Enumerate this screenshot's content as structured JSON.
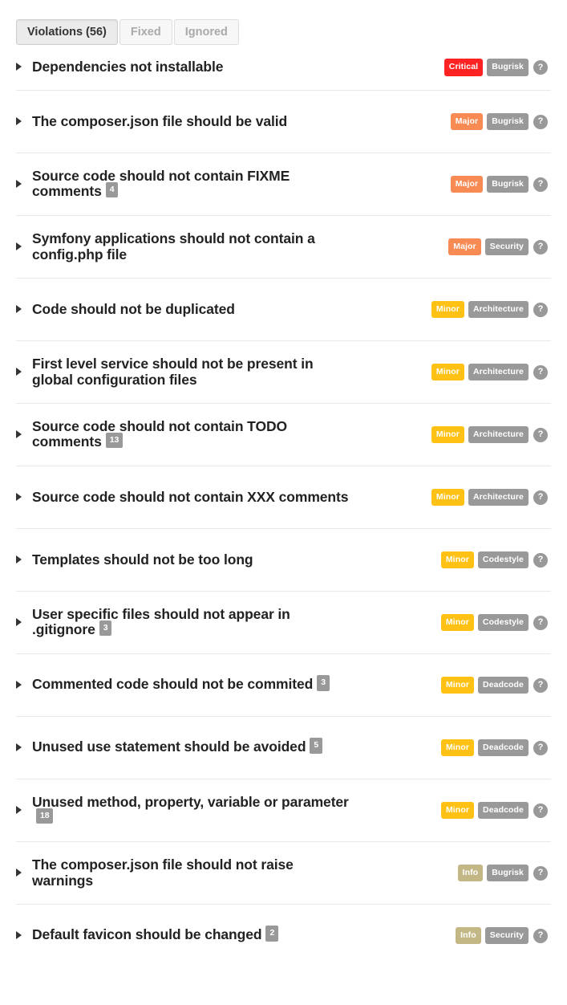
{
  "tabs": [
    {
      "label": "Violations (56)",
      "active": true
    },
    {
      "label": "Fixed",
      "active": false
    },
    {
      "label": "Ignored",
      "active": false
    }
  ],
  "help_icon_label": "?",
  "violations": [
    {
      "title": "Dependencies not installable",
      "count": "",
      "severity": "Critical",
      "severity_key": "critical",
      "category": "Bugrisk"
    },
    {
      "title": "The composer.json file should be valid",
      "count": "",
      "severity": "Major",
      "severity_key": "major",
      "category": "Bugrisk"
    },
    {
      "title": "Source code should not contain FIXME comments",
      "count": "4",
      "severity": "Major",
      "severity_key": "major",
      "category": "Bugrisk"
    },
    {
      "title": "Symfony applications should not contain a config.php file",
      "count": "",
      "severity": "Major",
      "severity_key": "major",
      "category": "Security"
    },
    {
      "title": "Code should not be duplicated",
      "count": "",
      "severity": "Minor",
      "severity_key": "minor",
      "category": "Architecture"
    },
    {
      "title": "First level service should not be present in global configuration files",
      "count": "",
      "severity": "Minor",
      "severity_key": "minor",
      "category": "Architecture"
    },
    {
      "title": "Source code should not contain TODO comments",
      "count": "13",
      "severity": "Minor",
      "severity_key": "minor",
      "category": "Architecture"
    },
    {
      "title": "Source code should not contain XXX comments",
      "count": "",
      "severity": "Minor",
      "severity_key": "minor",
      "category": "Architecture"
    },
    {
      "title": "Templates should not be too long",
      "count": "",
      "severity": "Minor",
      "severity_key": "minor",
      "category": "Codestyle"
    },
    {
      "title": "User specific files should not appear in .gitignore",
      "count": "3",
      "severity": "Minor",
      "severity_key": "minor",
      "category": "Codestyle"
    },
    {
      "title": "Commented code should not be commited",
      "count": "3",
      "severity": "Minor",
      "severity_key": "minor",
      "category": "Deadcode"
    },
    {
      "title": "Unused use statement should be avoided",
      "count": "5",
      "severity": "Minor",
      "severity_key": "minor",
      "category": "Deadcode"
    },
    {
      "title": "Unused method, property, variable or parameter",
      "count": "18",
      "severity": "Minor",
      "severity_key": "minor",
      "category": "Deadcode"
    },
    {
      "title": "The composer.json file should not raise warnings",
      "count": "",
      "severity": "Info",
      "severity_key": "info",
      "category": "Bugrisk"
    },
    {
      "title": "Default favicon should be changed",
      "count": "2",
      "severity": "Info",
      "severity_key": "info",
      "category": "Security"
    }
  ],
  "colors": {
    "critical": "#ff2222",
    "major": "#f88a53",
    "minor": "#ffc113",
    "info": "#c3b785",
    "category": "#999999",
    "divider": "#e9e9e9"
  }
}
